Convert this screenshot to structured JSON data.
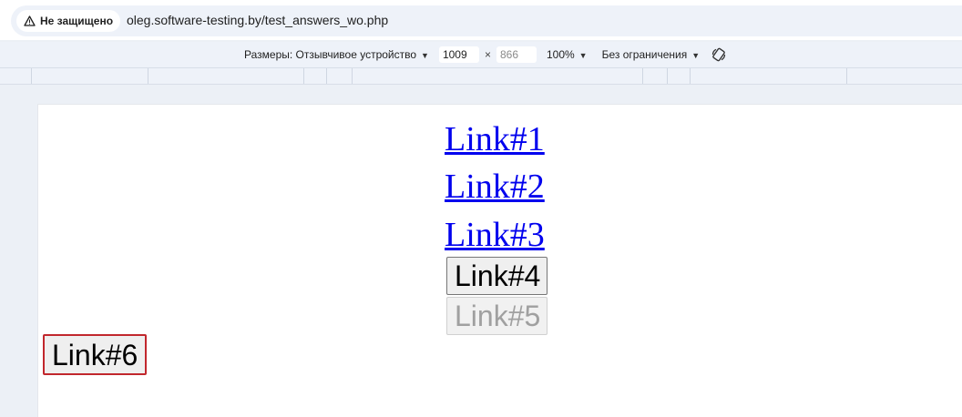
{
  "browser": {
    "security_label": "Не защищено",
    "url": "oleg.software-testing.by/test_answers_wo.php"
  },
  "devtools": {
    "dimensions_label": "Размеры: Отзывчивое устройство",
    "width": "1009",
    "height_placeholder": "866",
    "zoom": "100%",
    "throttling": "Без ограничения"
  },
  "page": {
    "links": [
      "Link#1",
      "Link#2",
      "Link#3"
    ],
    "button4": "Link#4",
    "button5": "Link#5",
    "button6": "Link#6"
  }
}
